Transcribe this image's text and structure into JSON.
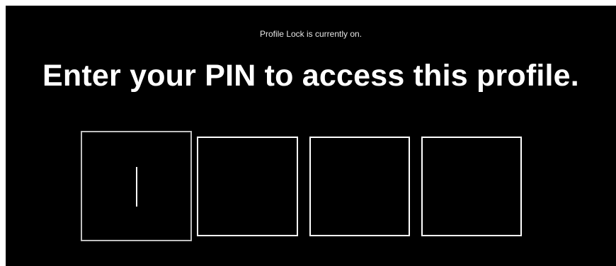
{
  "status": {
    "text": "Profile Lock is currently on."
  },
  "title": {
    "text": "Enter your PIN to access this profile."
  },
  "pin": {
    "digits": 4,
    "focused_index": 0,
    "values": [
      "",
      "",
      "",
      ""
    ]
  },
  "colors": {
    "background": "#000000",
    "text": "#ffffff",
    "focused_border": "#bfbfbf",
    "box_border": "#ffffff"
  }
}
